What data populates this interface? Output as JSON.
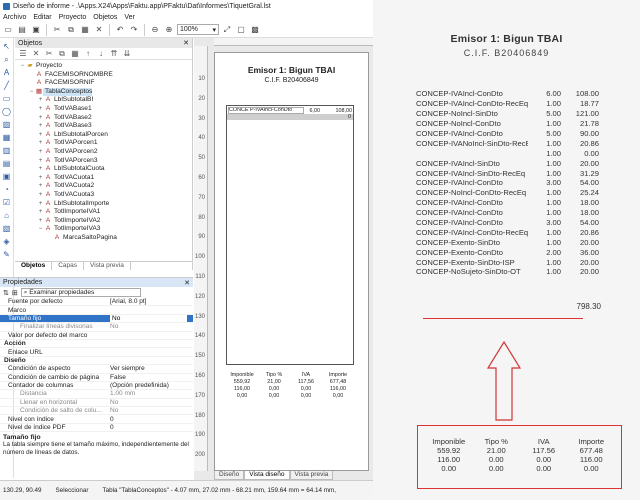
{
  "window": {
    "title": "Diseño de informe - .\\Apps.X24\\Apps\\Faktu.app\\PFaktu\\Dat\\Informes\\TiquetGral.lst"
  },
  "menu": [
    "Archivo",
    "Editar",
    "Proyecto",
    "Objetos",
    "Ver"
  ],
  "toolbar": {
    "zoom": "100%"
  },
  "objects_panel": {
    "title": "Objetos",
    "tree": [
      {
        "label": "Proyecto",
        "level": 0,
        "icon": "folder",
        "toggle": "−"
      },
      {
        "label": "FACEMISORNOMBRE",
        "level": 1,
        "icon": "text",
        "toggle": ""
      },
      {
        "label": "FACEMISORNIF",
        "level": 1,
        "icon": "text",
        "toggle": ""
      },
      {
        "label": "TablaConceptos",
        "level": 1,
        "icon": "table",
        "toggle": "−",
        "selected": true
      },
      {
        "label": "LblSubtotalBI",
        "level": 2,
        "icon": "text",
        "toggle": "+"
      },
      {
        "label": "TotIVABase1",
        "level": 2,
        "icon": "text",
        "toggle": "+"
      },
      {
        "label": "TotIVABase2",
        "level": 2,
        "icon": "text",
        "toggle": "+"
      },
      {
        "label": "TotIVABase3",
        "level": 2,
        "icon": "text",
        "toggle": "+"
      },
      {
        "label": "LblSubtotalPorcen",
        "level": 2,
        "icon": "text",
        "toggle": "+"
      },
      {
        "label": "TotIVAPorcen1",
        "level": 2,
        "icon": "text",
        "toggle": "+"
      },
      {
        "label": "TotIVAPorcen2",
        "level": 2,
        "icon": "text",
        "toggle": "+"
      },
      {
        "label": "TotIVAPorcen3",
        "level": 2,
        "icon": "text",
        "toggle": "+"
      },
      {
        "label": "LblSubtotalCuota",
        "level": 2,
        "icon": "text",
        "toggle": "+"
      },
      {
        "label": "TotIVACuota1",
        "level": 2,
        "icon": "text",
        "toggle": "+"
      },
      {
        "label": "TotIVACuota2",
        "level": 2,
        "icon": "text",
        "toggle": "+"
      },
      {
        "label": "TotIVACuota3",
        "level": 2,
        "icon": "text",
        "toggle": "+"
      },
      {
        "label": "LblSubtotalImporte",
        "level": 2,
        "icon": "text",
        "toggle": "+"
      },
      {
        "label": "TotlImporteIVA1",
        "level": 2,
        "icon": "text",
        "toggle": "+"
      },
      {
        "label": "TotlImporteIVA2",
        "level": 2,
        "icon": "text",
        "toggle": "+"
      },
      {
        "label": "TotlImporteIVA3",
        "level": 2,
        "icon": "text",
        "toggle": "−"
      },
      {
        "label": "MarcaSaltoPagina",
        "level": 3,
        "icon": "text",
        "toggle": ""
      }
    ],
    "tabs": [
      "Objetos",
      "Capas",
      "Vista previa"
    ]
  },
  "properties_panel": {
    "title": "Propiedades",
    "selector": "Examinar propiedades",
    "rows": [
      {
        "key": "Fuente por defecto",
        "value": "[Arial, 8.0 pt]",
        "type": "row"
      },
      {
        "key": "Marco",
        "value": "",
        "type": "row"
      },
      {
        "key": "Tamaño fijo",
        "value": "No",
        "type": "sel"
      },
      {
        "key": "Finalizar líneas divisorias",
        "value": "No",
        "type": "sub"
      },
      {
        "key": "Valor por defecto del marco",
        "value": "",
        "type": "row"
      },
      {
        "key": "Acción",
        "value": "",
        "type": "cat"
      },
      {
        "key": "Enlace URL",
        "value": "",
        "type": "row"
      },
      {
        "key": "Diseño",
        "value": "",
        "type": "cat"
      },
      {
        "key": "Condición de aspecto",
        "value": "Ver siempre",
        "type": "row"
      },
      {
        "key": "Condición de cambio de página",
        "value": "False",
        "type": "row"
      },
      {
        "key": "Contador de columnas",
        "value": "(Opción predefinida)",
        "type": "row"
      },
      {
        "key": "Distancia",
        "value": "1.00 mm",
        "type": "sub"
      },
      {
        "key": "Llenar en horizontal",
        "value": "No",
        "type": "sub"
      },
      {
        "key": "Condición de salto de colu...",
        "value": "No",
        "type": "sub"
      },
      {
        "key": "Nivel con índice",
        "value": "0",
        "type": "row"
      },
      {
        "key": "Nivel de índice PDF",
        "value": "0",
        "type": "row"
      }
    ],
    "help_title": "Tamaño fijo",
    "help_text": "La tabla siempre tiene el tamaño máximo, independientemente del número de líneas de datos."
  },
  "status": {
    "coords": "130.29, 90.49",
    "mode": "Seleccionar",
    "object": "Tabla \"TablaConceptos\" - 4.07 mm, 27.02 mm - 68.21 mm, 159.64 mm = 64.14 mm,"
  },
  "design": {
    "ruler_marks": [
      "10",
      "20",
      "30",
      "40",
      "50",
      "60",
      "70",
      "80",
      "90",
      "100",
      "110",
      "120",
      "130",
      "140",
      "150",
      "160",
      "170",
      "180",
      "190",
      "200"
    ],
    "title": "Emisor 1: Bigun TBAI",
    "cif": "C.I.F. B20406849",
    "row": {
      "concept": "CONCE P-IVAIncl-ConDto",
      "qty": "6,00",
      "total": "108,00"
    },
    "row2_value": "0",
    "footer_rows": [
      [
        "Imponible",
        "Tipo %",
        "IVA",
        "Importe"
      ],
      [
        "559,92",
        "21,00",
        "117,56",
        "677,48"
      ],
      [
        "116,00",
        "0,00",
        "0,00",
        "116,00"
      ],
      [
        "0,00",
        "0,00",
        "0,00",
        "0,00"
      ]
    ],
    "tabs": [
      "Diseño",
      "Vista diseño",
      "Vista previa"
    ]
  },
  "receipt": {
    "title": "Emisor 1: Bigun TBAI",
    "cif": "C.I.F. B20406849",
    "lines": [
      [
        "CONCEP-IVAIncl-ConDto",
        "6.00",
        "108.00"
      ],
      [
        "CONCEP-IVAIncl-ConDto-RecEq",
        "1.00",
        "18.77"
      ],
      [
        "CONCEP-NoIncl-SinDto",
        "5.00",
        "121.00"
      ],
      [
        "CONCEP-NoIncl-ConDto",
        "1.00",
        "21.78"
      ],
      [
        "CONCEP-IVAIncl-ConDto",
        "5.00",
        "90.00"
      ],
      [
        "CONCEP-IVANoIncl-SinDto-RecEq",
        "1.00",
        "20.86"
      ],
      [
        "",
        "1.00",
        "0.00"
      ],
      [
        "CONCEP-IVAIncl-SinDto",
        "1.00",
        "20.00"
      ],
      [
        "CONCEP-IVAIncl-SinDto-RecEq",
        "1.00",
        "31.29"
      ],
      [
        "CONCEP-IVAIncl-ConDto",
        "3.00",
        "54.00"
      ],
      [
        "CONCEP-NoIncl-ConDto-RecEq",
        "1.00",
        "25.24"
      ],
      [
        "CONCEP-IVAIncl-ConDto",
        "1.00",
        "18.00"
      ],
      [
        "CONCEP-IVAIncl-ConDto",
        "1.00",
        "18.00"
      ],
      [
        "CONCEP-IVAIncl-ConDto",
        "3.00",
        "54.00"
      ],
      [
        "CONCEP-IVAIncl-ConDto-RecEq",
        "1.00",
        "20.86"
      ],
      [
        "CONCEP-Exento-SinDto",
        "1.00",
        "20.00"
      ],
      [
        "CONCEP-Exento-ConDto",
        "2.00",
        "36.00"
      ],
      [
        "CONCEP-Exento-SinDto-ISP",
        "1.00",
        "20.00"
      ],
      [
        "CONCEP-NoSujeto-SinDto-OT",
        "1.00",
        "20.00"
      ]
    ],
    "total": "798.30",
    "footer_rows": [
      [
        "Imponible",
        "Tipo %",
        "IVA",
        "Importe"
      ],
      [
        "559.92",
        "21.00",
        "117.56",
        "677.48"
      ],
      [
        "116.00",
        "0.00",
        "0.00",
        "116.00"
      ],
      [
        "0.00",
        "0.00",
        "0.00",
        "0.00"
      ]
    ],
    "accent_color": "#d33333"
  }
}
